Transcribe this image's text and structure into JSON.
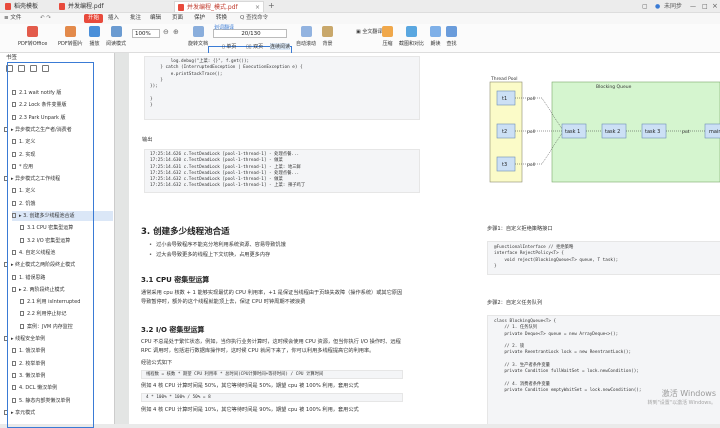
{
  "tabs": [
    {
      "label": "稻壳模板",
      "color": "#e84a3c"
    },
    {
      "label": "并发编程.pdf",
      "color": "#e84a3c"
    },
    {
      "label": "并发编程_模式.pdf",
      "color": "#e84a3c"
    }
  ],
  "window": {
    "user": "未同步",
    "close": "×"
  },
  "menu": {
    "file": "≡ 文件",
    "start": "开始",
    "items": [
      "插入",
      "批注",
      "编辑",
      "页面",
      "保护",
      "转换"
    ],
    "search": "Q 查找命令"
  },
  "toolbar": {
    "buttons": [
      "PDF转Office",
      "PDF转图片",
      "播放",
      "阅读模式",
      "旋转文档",
      "单页",
      "双页",
      "连续阅读",
      "自动滚动",
      "背景",
      "全文翻译",
      "压缩",
      "截图和对比",
      "朗读",
      "查找"
    ],
    "zoom": "100%",
    "page_input": "20",
    "page_total": "/130",
    "highlight": "划词翻译"
  },
  "sidebar": {
    "title": "书签",
    "toc": [
      {
        "label": "2.1 wait notify 版",
        "level": 2
      },
      {
        "label": "2.2 Lock 条件变量版",
        "level": 2
      },
      {
        "label": "2.3 Park Unpark 版",
        "level": 2
      },
      {
        "label": "▸ 异步模式之生产者/消费者",
        "level": 1
      },
      {
        "label": "1. 定义",
        "level": 2
      },
      {
        "label": "2. 实现",
        "level": 2
      },
      {
        "label": "* 应用",
        "level": 2
      },
      {
        "label": "▸ 异步模式之工作线程",
        "level": 1
      },
      {
        "label": "1. 定义",
        "level": 2
      },
      {
        "label": "2. 饥饿",
        "level": 2
      },
      {
        "label": "▸ 3. 创建多少线程池合适",
        "level": 2
      },
      {
        "label": "3.1 CPU 密集型运算",
        "level": 3
      },
      {
        "label": "3.2 I/O 密集型运算",
        "level": 3
      },
      {
        "label": "4. 自定义线程池",
        "level": 2
      },
      {
        "label": "▸ 终止模式之两阶段终止模式",
        "level": 1
      },
      {
        "label": "1. 错误思路",
        "level": 2
      },
      {
        "label": "▸ 2. 两阶段终止模式",
        "level": 2
      },
      {
        "label": "2.1 利用 isInterrupted",
        "level": 3
      },
      {
        "label": "2.2 利用停止标记",
        "level": 3
      },
      {
        "label": "案例：JVM 内存监控",
        "level": 3
      },
      {
        "label": "▸ 线程安全单例",
        "level": 1
      },
      {
        "label": "1. 饿汉单例",
        "level": 2
      },
      {
        "label": "2. 枚举单例",
        "level": 2
      },
      {
        "label": "3. 懒汉单例",
        "level": 2
      },
      {
        "label": "4. DCL 懒汉单例",
        "level": 2
      },
      {
        "label": "5. 静态内部类懒汉单例",
        "level": 2
      },
      {
        "label": "▸ 享元模式",
        "level": 1
      }
    ]
  },
  "doc": {
    "code_top": [
      "        log.debug(\"上菜: {}\", f.get());",
      "    } catch (InterruptedException | ExecutionException e) {",
      "        e.printStackTrace();",
      "    }",
      "});",
      "",
      "}",
      "}"
    ],
    "output_label": "输出",
    "output_lines": [
      "17:25:14.626 c.TestDeadLock [pool-1-thread-1] - 处理点餐...",
      "17:25:14.630 c.TestDeadLock [pool-1-thread-1] - 做菜",
      "17:25:14.631 c.TestDeadLock [pool-1-thread-1] - 上菜: 地三鲜",
      "17:25:14.632 c.TestDeadLock [pool-1-thread-1] - 处理点餐...",
      "17:25:14.632 c.TestDeadLock [pool-1-thread-1] - 做菜",
      "17:25:14.632 c.TestDeadLock [pool-1-thread-1] - 上菜: 辣子鸡丁"
    ],
    "h2": "3. 创建多少线程池合适",
    "bullets": [
      "过小会导致程序不能充分地利用系统资源、容易导致饥饿",
      "过大会导致更多的线程上下文切换，占用更多内存"
    ],
    "h31": "3.1 CPU 密集型运算",
    "p31": [
      "通常采用 cpu 核数 + 1 能够实现最优的 CPU 利用率，+1 是保证当线程由于页缺失故障（操作系统）或其它原因",
      "导致暂停时，额外的这个线程就能顶上去，保证 CPU 时钟周期不被浪费"
    ],
    "h32": "3.2 I/O 密集型运算",
    "p32": [
      "CPU 不总是处于繁忙状态，例如，当你执行业务计算时，这时候会使用 CPU 资源，但当你执行 I/O 操作时、远程",
      "RPC 调用时，包括进行数据库操作时，这时候 CPU 就闲下来了，你可以利用多线程提高它的利用率。"
    ],
    "formula_label": "经验公式如下",
    "formula": "线程数 = 核数 * 期望 CPU 利用率 * 总时间(CPU计算时间+等待时间) / CPU 计算时间",
    "example1": "例如 4 核 CPU 计算时间是 50%，其它等待时间是 50%，期望 cpu 被 100% 利用，套用公式",
    "example1_formula": "4 * 100% * 100% / 50% = 8",
    "example2": "例如 4 核 CPU 计算时间是 10%，其它等待时间是 90%，期望 cpu 被 100% 利用，套用公式",
    "step1_label": "步骤1：自定义拒绝策略接口",
    "step1_code": [
      "@FunctionalInterface // 拒绝策略",
      "interface RejectPolicy<T> {",
      "    void reject(BlockingQueue<T> queue, T task);",
      "}"
    ],
    "step2_label": "步骤2：自定义任务队列",
    "step2_code": [
      "class BlockingQueue<T> {",
      "    // 1. 任务队列",
      "    private Deque<T> queue = new ArrayDeque<>();",
      "",
      "    // 2. 锁",
      "    private ReentrantLock lock = new ReentrantLock();",
      "",
      "    // 3. 生产者条件变量",
      "    private Condition fullWaitSet = lock.newCondition();",
      "",
      "    // 4. 消费者条件变量",
      "    private Condition emptyWaitSet = lock.newCondition();"
    ]
  },
  "diagram": {
    "pool_label": "Thread Pool",
    "queue_label": "Blocking Queue",
    "threads": [
      "t1",
      "t2",
      "t3"
    ],
    "poll": "poll",
    "tasks": [
      "task 1",
      "task 2",
      "task 3"
    ],
    "put": "put",
    "main": "main"
  },
  "watermark": {
    "line1": "激活 Windows",
    "line2": "转到\"设置\"以激活 Windows。"
  },
  "colors": {
    "accent": "#3a7bd5",
    "brand": "#e84a3c",
    "pool_fill": "#fbfbc8",
    "queue_fill": "#d5f5cf"
  }
}
